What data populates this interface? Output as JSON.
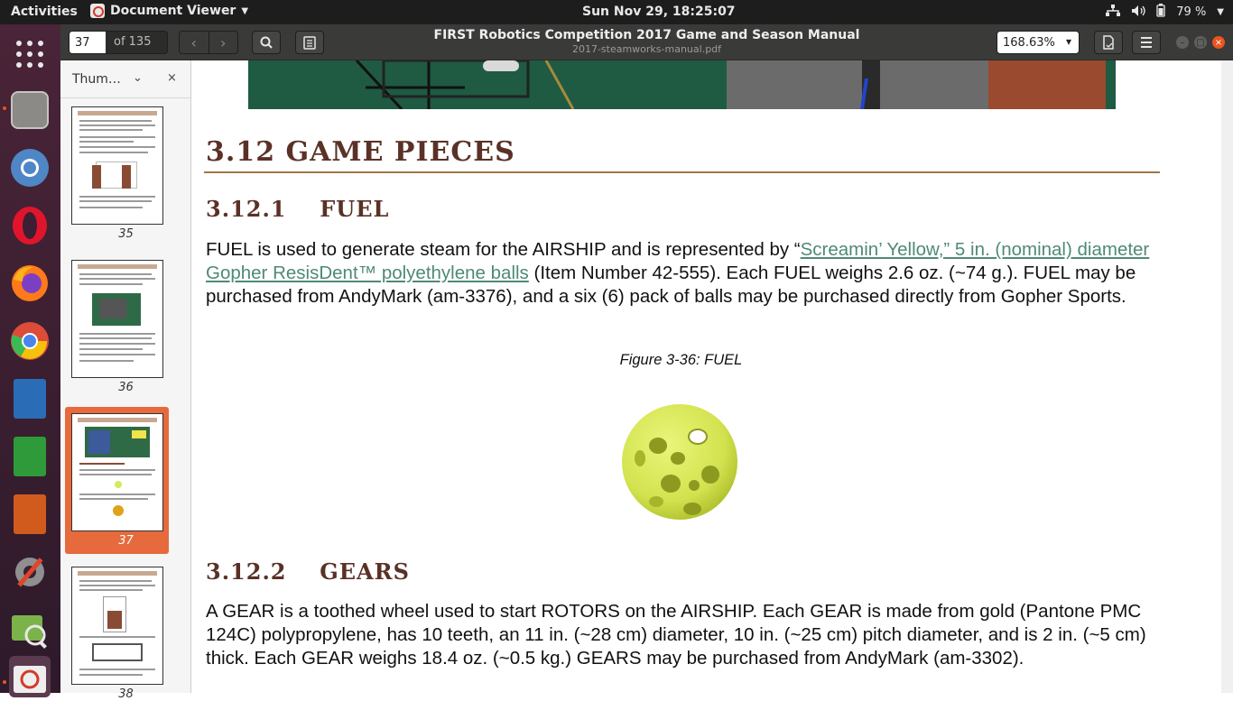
{
  "topbar": {
    "activities": "Activities",
    "app_name": "Document Viewer",
    "clock": "Sun Nov 29, 18:25:07",
    "battery": "79 %"
  },
  "window": {
    "page_current": "37",
    "page_total": "of 135",
    "title": "FIRST Robotics Competition 2017 Game and Season Manual",
    "subtitle": "2017-steamworks-manual.pdf",
    "zoom": "168.63%"
  },
  "sidebar": {
    "title": "Thum…",
    "thumbnails": [
      {
        "label": "35",
        "selected": false
      },
      {
        "label": "36",
        "selected": false
      },
      {
        "label": "37",
        "selected": true
      },
      {
        "label": "38",
        "selected": false
      }
    ]
  },
  "document": {
    "section_heading": "3.12 GAME PIECES",
    "fuel": {
      "number": "3.12.1",
      "title": "FUEL",
      "text_before_link": "FUEL is used to generate steam for the AIRSHIP and is represented by “",
      "link": "Screamin’ Yellow,” 5 in. (nominal) diameter Gopher ResisDent™ polyethylene balls",
      "text_after_link": " (Item Number 42-555). Each FUEL weighs 2.6 oz. (~74 g.). FUEL may be purchased from AndyMark (am-3376), and a six (6) pack of balls may be purchased directly from Gopher Sports.",
      "figure_caption": "Figure 3-36: FUEL"
    },
    "gears": {
      "number": "3.12.2",
      "title": "GEARS",
      "text": "A GEAR is a toothed wheel used to start ROTORS on the AIRSHIP. Each GEAR is made from gold (Pantone PMC 124C) polypropylene, has 10 teeth, an 11 in. (~28 cm) diameter, 10 in. (~25 cm) pitch diameter, and is 2 in. (~5 cm) thick. Each GEAR weighs 18.4 oz. (~0.5 kg.) GEARS may be purchased from AndyMark (am-3302)."
    }
  },
  "colors": {
    "heading": "#5a3126",
    "rule": "#a0764a",
    "link": "#4e8a74",
    "fuel_ball": "#d7e85a",
    "selection": "#e66a3c"
  }
}
